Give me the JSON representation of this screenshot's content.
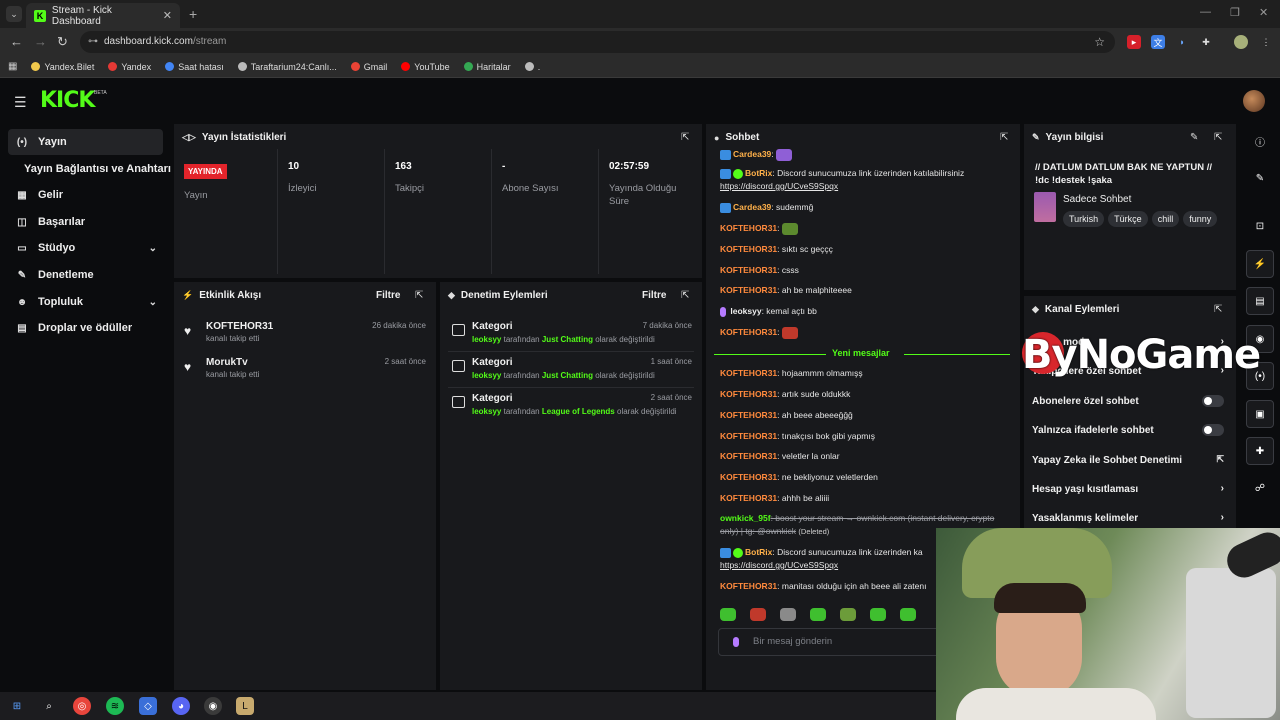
{
  "browser": {
    "tab_title": "Stream - Kick Dashboard",
    "tab_favicon": "K",
    "url_host": "dashboard.kick.com",
    "url_path": "/stream",
    "bookmarks": [
      {
        "label": "Yandex.Bilet",
        "color": "#f2c94c"
      },
      {
        "label": "Yandex",
        "color": "#e53935"
      },
      {
        "label": "Saat hatası",
        "color": "#4285f4"
      },
      {
        "label": "Taraftarium24:Canlı...",
        "color": "#bbbbbb"
      },
      {
        "label": "Gmail",
        "color": "#ea4335"
      },
      {
        "label": "YouTube",
        "color": "#ff0000"
      },
      {
        "label": "Haritalar",
        "color": "#34a853"
      },
      {
        "label": ".",
        "color": "#bbbbbb"
      }
    ]
  },
  "header": {
    "logo": "KICK",
    "beta": "BETA"
  },
  "sidebar": {
    "items": [
      {
        "label": "Yayın",
        "icon": "broadcast-icon",
        "glyph": "(•)"
      },
      {
        "label": "Yayın Bağlantısı ve Anahtarı",
        "icon": "",
        "glyph": ""
      },
      {
        "label": "Gelir",
        "icon": "revenue-icon",
        "glyph": "▦"
      },
      {
        "label": "Başarılar",
        "icon": "achievements-icon",
        "glyph": "◫"
      },
      {
        "label": "Stüdyo",
        "icon": "studio-icon",
        "glyph": "▭"
      },
      {
        "label": "Denetleme",
        "icon": "wrench-icon",
        "glyph": "✎"
      },
      {
        "label": "Topluluk",
        "icon": "community-icon",
        "glyph": "☻"
      },
      {
        "label": "Droplar ve ödüller",
        "icon": "drops-icon",
        "glyph": "▤"
      }
    ]
  },
  "stats": {
    "title": "Yayın İstatistikleri",
    "live_badge": "YAYINDA",
    "live_label": "Yayın",
    "cols": [
      {
        "value": "10",
        "label": "İzleyici"
      },
      {
        "value": "163",
        "label": "Takipçi"
      },
      {
        "value": "-",
        "label": "Abone Sayısı"
      },
      {
        "value": "02:57:59",
        "label": "Yayında Olduğu Süre"
      }
    ]
  },
  "activity": {
    "title": "Etkinlik Akışı",
    "filter": "Filtre",
    "items": [
      {
        "name": "KOFTEHOR31",
        "sub": "kanalı takip etti",
        "time": "26 dakika önce"
      },
      {
        "name": "MorukTv",
        "sub": "kanalı takip etti",
        "time": "2 saat önce"
      }
    ]
  },
  "moderation": {
    "title": "Denetim Eylemleri",
    "filter": "Filtre",
    "items": [
      {
        "name": "Kategori",
        "user": "leoksyy",
        "mid": "tarafından",
        "cat": "Just Chatting",
        "tail": "olarak değiştirildi",
        "time": "7 dakika önce"
      },
      {
        "name": "Kategori",
        "user": "leoksyy",
        "mid": "tarafından",
        "cat": "Just Chatting",
        "tail": "olarak değiştirildi",
        "time": "1 saat önce"
      },
      {
        "name": "Kategori",
        "user": "leoksyy",
        "mid": "tarafından",
        "cat": "League of Legends",
        "tail": "olarak değiştirildi",
        "time": "2 saat önce"
      }
    ]
  },
  "chat": {
    "title": "Sohbet",
    "new_messages": "Yeni mesajlar",
    "placeholder": "Bir mesaj gönderin",
    "lines": {
      "l1_user": "Cardea39",
      "l1_text": ":",
      "l2_user": "BotRix",
      "l2_text": ": Discord sunucumuza link üzerinden katılabilirsiniz",
      "l2_link": "https://discord.gg/UCveS9Spqx",
      "l3_user": "Cardea39",
      "l3_text": ": sudemmğ",
      "l4_user": "KOFTEHOR31",
      "l4_text": ":",
      "l5_user": "KOFTEHOR31",
      "l5_text": ": sıktı sc geççç",
      "l6_user": "KOFTEHOR31",
      "l6_text": ": csss",
      "l7_user": "KOFTEHOR31",
      "l7_text": ": ah be malphiteeee",
      "l8_user": "leoksyy",
      "l8_text": ": kemal açtı bb",
      "l9_user": "KOFTEHOR31",
      "l9_text": ":",
      "n1_user": "KOFTEHOR31",
      "n1_text": ": hojaammm olmamışş",
      "n2_user": "KOFTEHOR31",
      "n2_text": ": artık sude oldukkk",
      "n3_user": "KOFTEHOR31",
      "n3_text": ": ah beee abeeeğğğ",
      "n4_user": "KOFTEHOR31",
      "n4_text": ": tınakçısı bok gibi yapmış",
      "n5_user": "KOFTEHOR31",
      "n5_text": ": veletler la onlar",
      "n6_user": "KOFTEHOR31",
      "n6_text": ": ne bekliyonuz veletlerden",
      "n7_user": "KOFTEHOR31",
      "n7_text": ": ahhh be aliiii",
      "n8_user": "ownkick_95f",
      "n8_text": ": boost your stream → ownkick.com (instant delivery, crypto only) | tg: @ownkick",
      "n8_deleted": "(Deleted)",
      "n9_user": "BotRix",
      "n9_text": ": Discord sunucumuza link üzerinden ka",
      "n9_link": "https://discord.gg/UCveS9Spqx",
      "n10_user": "KOFTEHOR31",
      "n10_text": ": manitası olduğu için ah beee ali zatenı"
    }
  },
  "stream_info": {
    "title": "Yayın bilgisi",
    "stream_title": "// DATLUM DATLUM BAK NE YAPTUN // !dc !destek !şaka",
    "category": "Sadece Sohbet",
    "tags": [
      "Turkish",
      "Türkçe",
      "chill",
      "funny"
    ]
  },
  "channel_actions": {
    "title": "Kanal Eylemleri",
    "rows": [
      {
        "label": "Yavaş mod",
        "type": "chevron"
      },
      {
        "label": "Takipçilere özel sohbet",
        "type": "chevron"
      },
      {
        "label": "Abonelere özel sohbet",
        "type": "toggle"
      },
      {
        "label": "Yalnızca ifadelerle sohbet",
        "type": "toggle"
      },
      {
        "label": "Yapay Zeka ile Sohbet Denetimi",
        "type": "external"
      },
      {
        "label": "Hesap yaşı kısıtlaması",
        "type": "chevron"
      },
      {
        "label": "Yasaklanmış kelimeler",
        "type": "chevron"
      }
    ]
  },
  "overlay": {
    "watermark": "ByNoGame"
  },
  "colors": {
    "brand": "#53fc18",
    "live": "#e3242b",
    "username": "#ff8a3d"
  }
}
